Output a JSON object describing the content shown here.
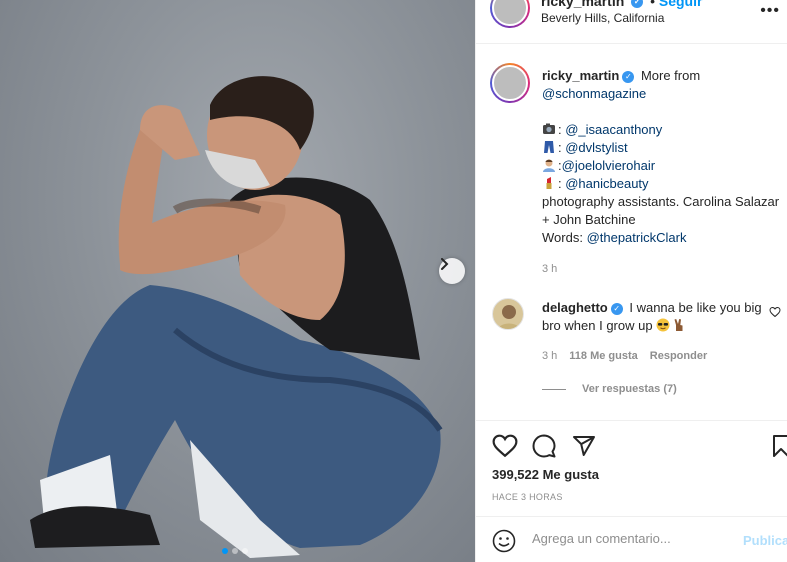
{
  "post": {
    "username": "ricky_martin",
    "follow_label": "Seguir",
    "separator": "•",
    "location": "Beverly Hills, California",
    "more_icon": "more-options-icon"
  },
  "caption": {
    "username": "ricky_martin",
    "text_start": "More from",
    "mention_magazine": "@schonmagazine",
    "credits": [
      {
        "icon": "camera-emoji",
        "sep": ": ",
        "handle": "@_isaacanthony"
      },
      {
        "icon": "jeans-emoji",
        "sep": ": ",
        "handle": "@dvlstylist"
      },
      {
        "icon": "haircut-emoji",
        "sep": ":",
        "handle": "@joelolvierohair"
      },
      {
        "icon": "lipstick-emoji",
        "sep": ": ",
        "handle": "@hanicbeauty"
      }
    ],
    "assistants": "photography assistants. Carolina Salazar + John Batchine",
    "words_label": "Words: ",
    "words_handle": "@thepatrickClark",
    "time": "3 h"
  },
  "comment": {
    "username": "delaghetto",
    "text": "I wanna be like you big bro when I grow up",
    "time": "3 h",
    "likes": "118 Me gusta",
    "reply_label": "Responder",
    "view_replies": "Ver respuestas (7)"
  },
  "actions": {
    "likes_count": "399,522 Me gusta",
    "time_ago": "HACE 3 HORAS"
  },
  "add_comment": {
    "placeholder": "Agrega un comentario...",
    "publish_label": "Publicar"
  },
  "carousel": {
    "total": 3,
    "active": 1
  },
  "colors": {
    "link": "#00376b",
    "accent": "#0095f6",
    "verified": "#3897f0",
    "muted": "#8e8e8e"
  }
}
